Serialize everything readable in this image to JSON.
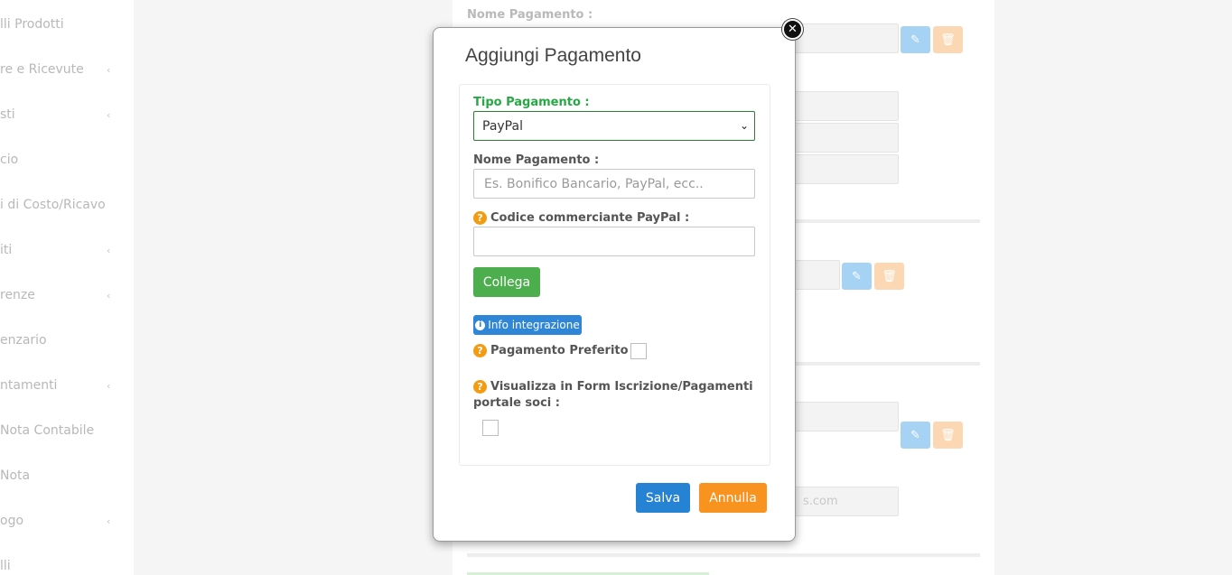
{
  "sidebar": {
    "items": [
      {
        "label": "lli Prodotti",
        "chevron": ""
      },
      {
        "label": "re e Ricevute",
        "chevron": "‹"
      },
      {
        "label": "sti",
        "chevron": "‹"
      },
      {
        "label": "cio",
        "chevron": ""
      },
      {
        "label": "i di Costo/Ricavo",
        "chevron": ""
      },
      {
        "label": "iti",
        "chevron": "‹"
      },
      {
        "label": "renze",
        "chevron": "‹"
      },
      {
        "label": "enzario",
        "chevron": ""
      },
      {
        "label": "ntamenti",
        "chevron": "‹"
      },
      {
        "label": "Nota Contabile",
        "chevron": ""
      },
      {
        "label": "Nota",
        "chevron": ""
      },
      {
        "label": "ogo",
        "chevron": "‹"
      },
      {
        "label": "lli",
        "chevron": ""
      }
    ]
  },
  "background": {
    "label_nome": "Nome Pagamento :",
    "email_fragment": "s.com"
  },
  "modal": {
    "title": "Aggiungi Pagamento",
    "close_glyph": "✕",
    "tipo_label": "Tipo Pagamento :",
    "tipo_value": "PayPal",
    "nome_label": "Nome Pagamento :",
    "nome_placeholder": "Es. Bonifico Bancario, PayPal, ecc..",
    "codice_label": "Codice commerciante PayPal :",
    "codice_value": "",
    "collega_label": "Collega",
    "info_label": "Info integrazione",
    "preferito_label": "Pagamento Preferito :",
    "visualizza_label_line1": "Visualizza in Form Iscrizione/Pagamenti",
    "visualizza_label_line2": "portale soci :",
    "save_label": "Salva",
    "cancel_label": "Annulla"
  },
  "icons": {
    "question": "?",
    "info": "i",
    "pencil": "✎",
    "trash": "🗑"
  },
  "colors": {
    "accent_green": "#28a745",
    "button_blue": "#2683d3",
    "button_orange": "#f7931e",
    "collega_green": "#4cae4c",
    "question_orange": "#f39c12"
  }
}
